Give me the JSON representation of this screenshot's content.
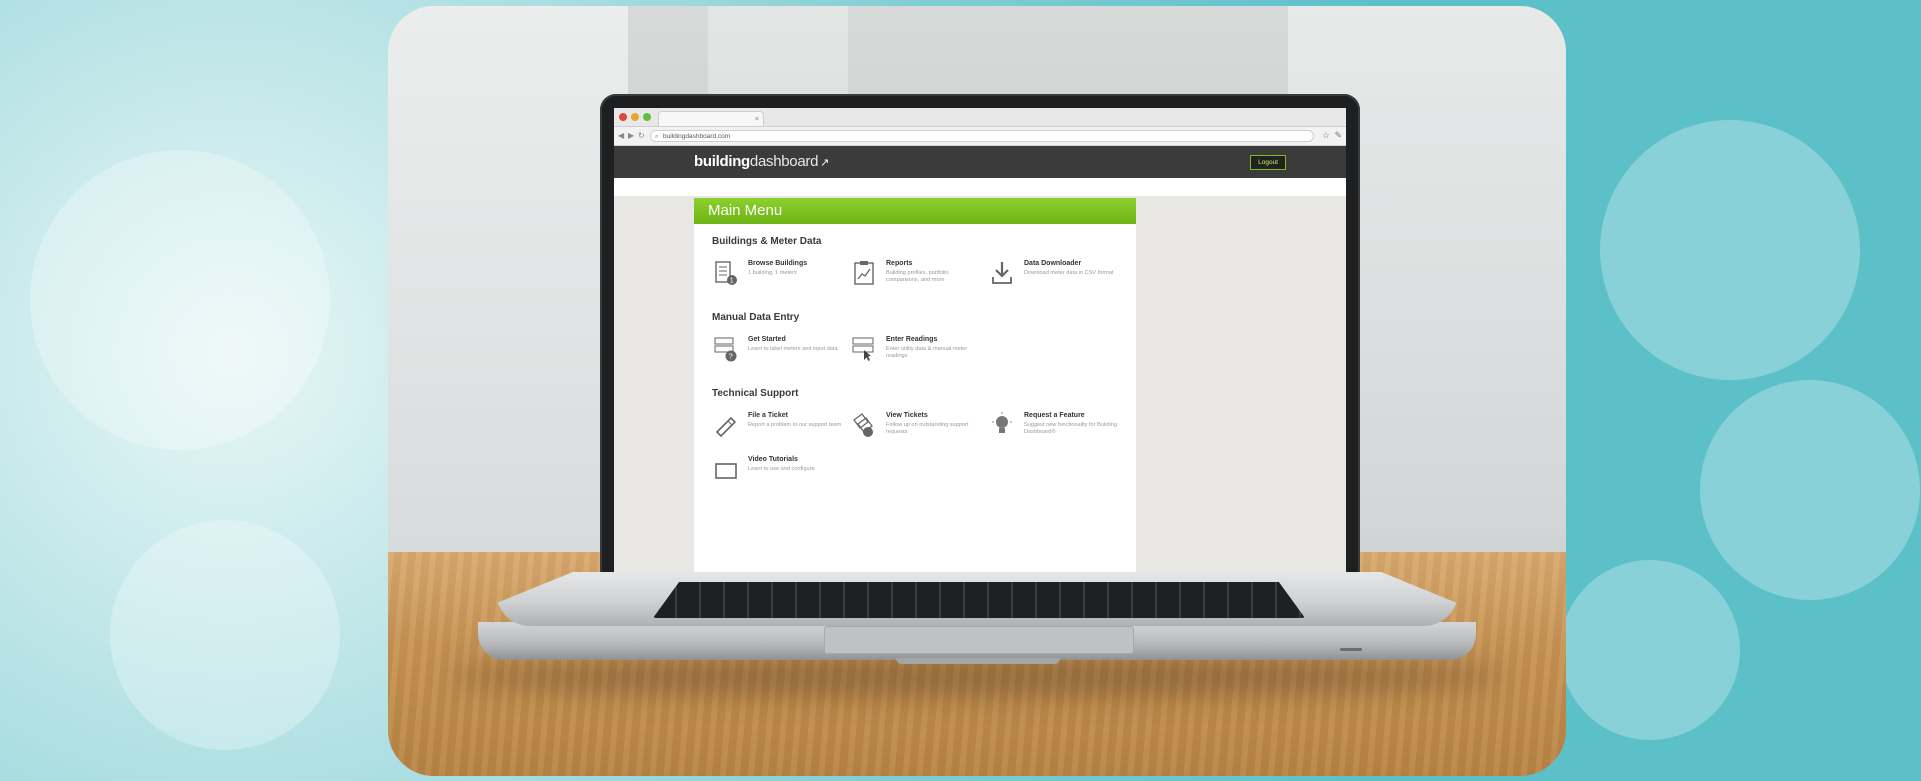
{
  "browser": {
    "tab_title": "",
    "url": "buildingdashboard.com",
    "traffic_light_colors": [
      "#e0463d",
      "#e7a72d",
      "#5fbf3b"
    ]
  },
  "app": {
    "logo_bold": "building",
    "logo_light": "dashboard",
    "logo_mark": "↗",
    "logout_label": "Logout",
    "accent_color": "#7bc21f"
  },
  "main_menu": {
    "title": "Main Menu",
    "sections": [
      {
        "title": "Buildings & Meter Data",
        "items": [
          {
            "title": "Browse Buildings",
            "description": "1 building, 1 meters",
            "icon": "building-list-icon"
          },
          {
            "title": "Reports",
            "description": "Building profiles, portfolio comparisons, and more",
            "icon": "report-chart-icon"
          },
          {
            "title": "Data Downloader",
            "description": "Download meter data in CSV format",
            "icon": "download-arrow-icon"
          }
        ]
      },
      {
        "title": "Manual Data Entry",
        "items": [
          {
            "title": "Get Started",
            "description": "Learn to label meters and input data",
            "icon": "meter-help-icon"
          },
          {
            "title": "Enter Readings",
            "description": "Enter utility data & manual meter readings",
            "icon": "meter-cursor-icon"
          }
        ]
      },
      {
        "title": "Technical Support",
        "items": [
          {
            "title": "File a Ticket",
            "description": "Report a problem to our support team",
            "icon": "pencil-ticket-icon"
          },
          {
            "title": "View Tickets",
            "description": "Follow up on outstanding support requests",
            "icon": "tickets-magnifier-icon"
          },
          {
            "title": "Request a Feature",
            "description": "Suggest new functionality for Building Dashboard®",
            "icon": "lightbulb-icon"
          },
          {
            "title": "Video Tutorials",
            "description": "Learn to use and configure",
            "icon": "video-screen-icon"
          }
        ]
      }
    ]
  }
}
